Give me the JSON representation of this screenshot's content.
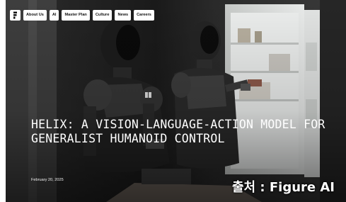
{
  "nav": {
    "items": [
      {
        "label": "About Us"
      },
      {
        "label": "AI"
      },
      {
        "label": "Master Plan"
      },
      {
        "label": "Culture"
      },
      {
        "label": "News"
      },
      {
        "label": "Careers"
      }
    ]
  },
  "article": {
    "headline": "HELIX: A VISION-LANGUAGE-ACTION MODEL FOR GENERALIST HUMANOID CONTROL",
    "date": "February 20, 2025"
  },
  "caption": {
    "source": "출처 : Figure AI"
  },
  "colors": {
    "nav_bg": "#ffffff",
    "headline": "#ffffff",
    "robot_body": "#1b1b1b",
    "fridge": "#d8dad8"
  }
}
